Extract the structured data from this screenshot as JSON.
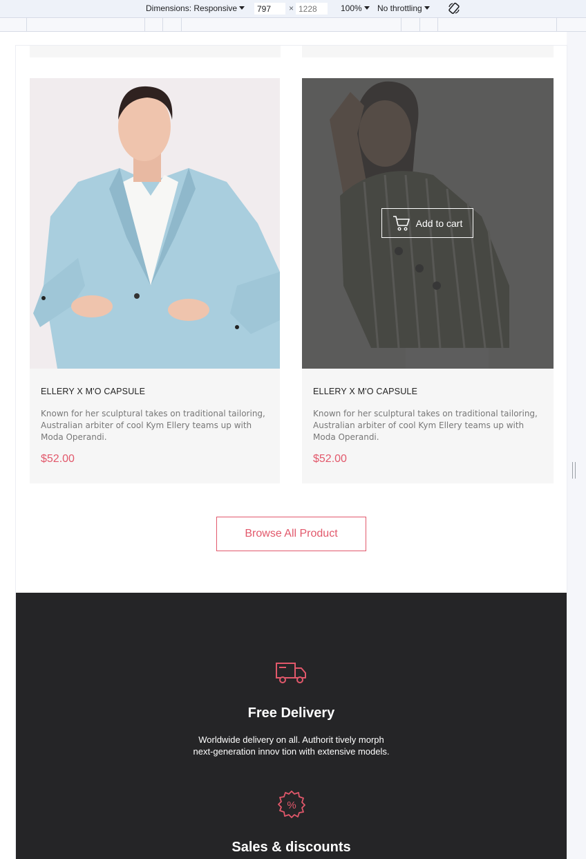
{
  "devtools": {
    "dimensions_label": "Dimensions: Responsive",
    "width_value": "797",
    "height_placeholder": "1228",
    "zoom": "100%",
    "throttling": "No throttling",
    "rotate_icon": "rotate-icon"
  },
  "products": [
    {
      "title": "ELLERY X M'O CAPSULE",
      "description": "Known for her sculptural takes on traditional tailoring, Australian arbiter of cool Kym Ellery teams up with Moda Operandi.",
      "price": "$52.00",
      "image": "woman-blue-blazer"
    },
    {
      "title": "ELLERY X M'O CAPSULE",
      "description": "Known for her sculptural takes on traditional tailoring, Australian arbiter of cool Kym Ellery teams up with Moda Operandi.",
      "price": "$52.00",
      "image": "woman-striped-shirt",
      "add_to_cart_label": "Add to cart",
      "cart_icon": "cart-icon"
    }
  ],
  "browse_label": "Browse All Product",
  "features": [
    {
      "icon": "truck-icon",
      "title": "Free Delivery",
      "text_line1": "Worldwide delivery on all. Authorit tively morph",
      "text_line2": "next-generation innov tion with extensive models."
    },
    {
      "icon": "discount-badge-icon",
      "icon_text": "%",
      "title": "Sales & discounts"
    }
  ],
  "colors": {
    "accent": "#e2586b",
    "dark_section": "#252527",
    "card_bg": "#f6f6f6"
  }
}
